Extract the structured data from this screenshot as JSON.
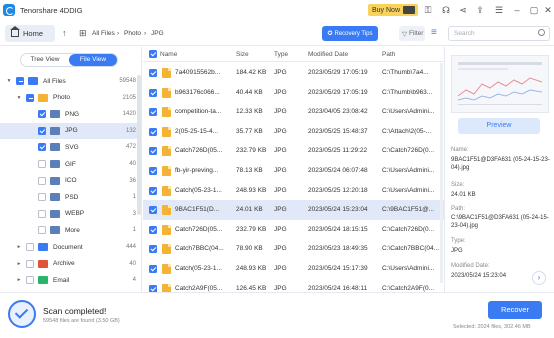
{
  "app": {
    "title": "Tenorshare 4DDIG",
    "buy_now": "Buy Now"
  },
  "toolbar": {
    "home": "Home",
    "breadcrumb": [
      "All Files",
      "Photo",
      "JPG"
    ],
    "recovery_tips": "Recovery Tips",
    "filter": "Filter",
    "search_placeholder": "Search"
  },
  "view_toggle": {
    "tree_view": "Tree View",
    "file_view": "File View",
    "active": "File View"
  },
  "tree": [
    {
      "label": "All Files",
      "count": "59548",
      "level": 0,
      "expanded": true,
      "check": "part",
      "color": "#3a7bf4",
      "selected": false
    },
    {
      "label": "Photo",
      "count": "2105",
      "level": 1,
      "expanded": true,
      "check": "part",
      "color": "#f5b335",
      "selected": false
    },
    {
      "label": "PNG",
      "count": "1420",
      "level": 2,
      "expanded": false,
      "check": "on",
      "color": "#5b7fb8",
      "selected": false
    },
    {
      "label": "JPG",
      "count": "132",
      "level": 2,
      "expanded": false,
      "check": "on",
      "color": "#5b7fb8",
      "selected": true
    },
    {
      "label": "SVG",
      "count": "472",
      "level": 2,
      "expanded": false,
      "check": "on",
      "color": "#5b7fb8",
      "selected": false
    },
    {
      "label": "GIF",
      "count": "40",
      "level": 2,
      "expanded": false,
      "check": "off",
      "color": "#5b7fb8",
      "selected": false
    },
    {
      "label": "ICO",
      "count": "36",
      "level": 2,
      "expanded": false,
      "check": "off",
      "color": "#5b7fb8",
      "selected": false
    },
    {
      "label": "PSD",
      "count": "1",
      "level": 2,
      "expanded": false,
      "check": "off",
      "color": "#5b7fb8",
      "selected": false
    },
    {
      "label": "WEBP",
      "count": "3",
      "level": 2,
      "expanded": false,
      "check": "off",
      "color": "#5b7fb8",
      "selected": false
    },
    {
      "label": "More",
      "count": "1",
      "level": 2,
      "expanded": false,
      "check": "off",
      "color": "#5b7fb8",
      "selected": false
    },
    {
      "label": "Document",
      "count": "444",
      "level": 1,
      "expanded": false,
      "check": "off",
      "color": "#3a7bf4",
      "selected": false
    },
    {
      "label": "Archive",
      "count": "40",
      "level": 1,
      "expanded": false,
      "check": "off",
      "color": "#e0533d",
      "selected": false
    },
    {
      "label": "Email",
      "count": "4",
      "level": 1,
      "expanded": false,
      "check": "off",
      "color": "#28b46a",
      "selected": false
    }
  ],
  "table": {
    "columns": [
      "Name",
      "Size",
      "Type",
      "Modified Date",
      "Path"
    ],
    "rows": [
      {
        "name": "7a40915562b...",
        "size": "184.42 KB",
        "type": "JPG",
        "date": "2023/05/29 17:05:19",
        "path": "C:\\Thumb\\7a4...",
        "selected": false
      },
      {
        "name": "b963176c066...",
        "size": "40.44 KB",
        "type": "JPG",
        "date": "2023/05/29 17:05:19",
        "path": "C:\\Thumb\\b963...",
        "selected": false
      },
      {
        "name": "competition-ta...",
        "size": "12.33 KB",
        "type": "JPG",
        "date": "2023/04/05 23:08:42",
        "path": "C:\\Users\\Admini...",
        "selected": false
      },
      {
        "name": "2(05-25-15-4...",
        "size": "35.77 KB",
        "type": "JPG",
        "date": "2023/05/25 15:48:37",
        "path": "C:\\Attach\\2(05-...",
        "selected": false
      },
      {
        "name": "Catch726D(05...",
        "size": "232.79 KB",
        "type": "JPG",
        "date": "2023/05/25 11:29:22",
        "path": "C:\\Catch726D(0...",
        "selected": false
      },
      {
        "name": "fb-yir-preving...",
        "size": "78.13 KB",
        "type": "JPG",
        "date": "2023/05/24 06:07:48",
        "path": "C:\\Users\\Admini...",
        "selected": false
      },
      {
        "name": "Catch(05-23-1...",
        "size": "248.93 KB",
        "type": "JPG",
        "date": "2023/05/25 12:20:18",
        "path": "C:\\Users\\Admini...",
        "selected": false
      },
      {
        "name": "9BAC1F51(D...",
        "size": "24.01 KB",
        "type": "JPG",
        "date": "2023/05/24 15:23:04",
        "path": "C:\\9BAC1F51@...",
        "selected": true
      },
      {
        "name": "Catch726D(05...",
        "size": "232.79 KB",
        "type": "JPG",
        "date": "2023/05/24 18:15:15",
        "path": "C:\\Catch726D(0...",
        "selected": false
      },
      {
        "name": "Catch7BBC(04...",
        "size": "78.90 KB",
        "type": "JPG",
        "date": "2023/05/23 18:49:35",
        "path": "C:\\Catch7BBC(04...",
        "selected": false
      },
      {
        "name": "Catch(05-23-1...",
        "size": "248.93 KB",
        "type": "JPG",
        "date": "2023/05/24 15:17:39",
        "path": "C:\\Users\\Admini...",
        "selected": false
      },
      {
        "name": "Catch2A9F(05...",
        "size": "126.45 KB",
        "type": "JPG",
        "date": "2023/05/24 16:48:11",
        "path": "C:\\Catch2A9F(0...",
        "selected": false
      }
    ]
  },
  "preview": {
    "button": "Preview",
    "name_label": "Name:",
    "name_value": "9BAC1F51@D3FA631 (05-24-15-23-04).jpg",
    "size_label": "Size:",
    "size_value": "24.01 KB",
    "path_label": "Path:",
    "path_value": "C:\\9BAC1F51@D3FA631 (05-24-15-23-04).jpg",
    "type_label": "Type:",
    "type_value": "JPG",
    "modified_label": "Modified Date:",
    "modified_value": "2023/05/24 15:23:04"
  },
  "status": {
    "title": "Scan completed!",
    "subtitle": "59548 files are found (3.50 GB)",
    "recover": "Recover",
    "selected_info": "Selected: 2024 files, 302.46 MB"
  },
  "colors": {
    "accent": "#3a7bf4",
    "selected_row": "#e1e9f9",
    "buy_now": "#f8d25a"
  }
}
